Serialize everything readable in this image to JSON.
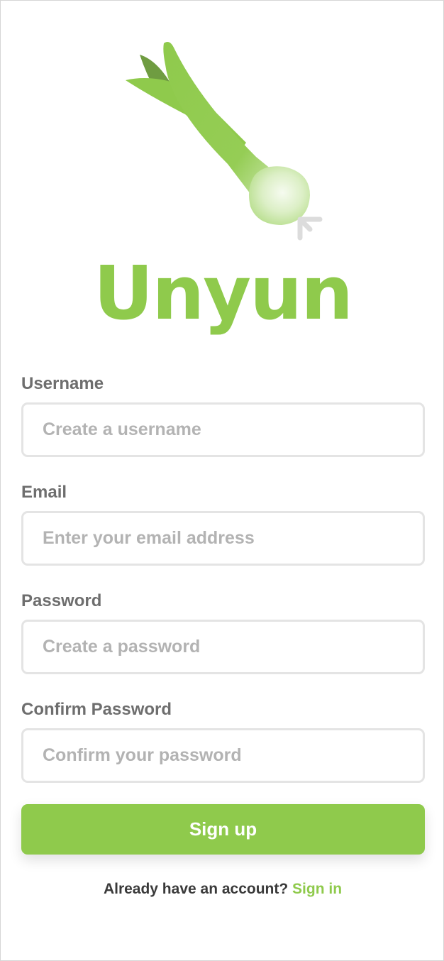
{
  "brand": {
    "logo_icon": "green-onion-icon",
    "name": "Unyun",
    "color": "#8fca4c"
  },
  "form": {
    "username": {
      "label": "Username",
      "placeholder": "Create a username",
      "value": ""
    },
    "email": {
      "label": "Email",
      "placeholder": "Enter your email address",
      "value": ""
    },
    "password": {
      "label": "Password",
      "placeholder": "Create a password",
      "value": ""
    },
    "confirm_password": {
      "label": "Confirm Password",
      "placeholder": "Confirm your password",
      "value": ""
    },
    "submit_label": "Sign up"
  },
  "footer": {
    "prompt": "Already have an account?",
    "link_label": "Sign in"
  },
  "colors": {
    "accent": "#8fca4c",
    "label": "#6e6e6e",
    "placeholder": "#b3b3b3",
    "input_border": "#e4e4e4"
  }
}
